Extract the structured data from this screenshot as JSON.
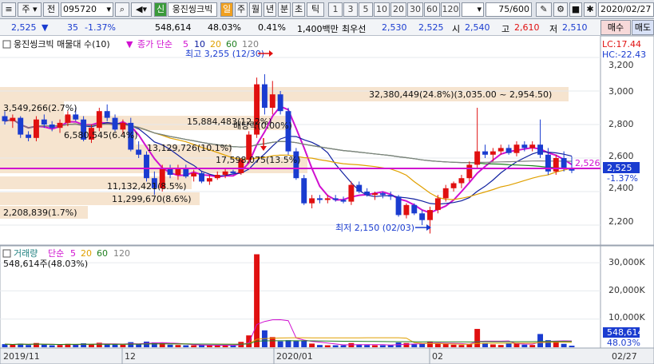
{
  "toolbar": {
    "menu_icon": "lines-icon",
    "market_label": "주",
    "period_label": "전",
    "code_value": "095720",
    "search_icon": "search-icon",
    "sound_icon": "speaker-icon",
    "new_label": "신",
    "stock_name": "웅진씽크빅",
    "tab_labels": [
      "일",
      "주",
      "월",
      "년",
      "분",
      "초",
      "틱"
    ],
    "number_tabs": [
      "1",
      "3",
      "5",
      "10",
      "20",
      "30",
      "60",
      "120"
    ],
    "count_value": "75",
    "count_total": "/600",
    "date_value": "2020/02/27"
  },
  "infobar": {
    "price": "2,525",
    "change": "35",
    "change_pct": "-1.37%",
    "volume": "548,614",
    "volume_ratio": "48.03%",
    "turnover": "0.41%",
    "trade_value": "1,400백만",
    "best_bid_label": "최우선",
    "ask": "2,530",
    "bid": "2,525",
    "open_label": "시",
    "open": "2,540",
    "high_label": "고",
    "high": "2,610",
    "low_label": "저",
    "low": "2,510",
    "buy_label": "매수",
    "sell_label": "매도"
  },
  "price_panel": {
    "title": "웅진씽크빅 매물대 수(10)",
    "ma_label": "종가 단순",
    "ma_periods": [
      "5",
      "10",
      "20",
      "60",
      "120"
    ],
    "ma_colors": [
      "#d010d0",
      "#1020a0",
      "#e0a000",
      "#208020",
      "#808080"
    ],
    "lc_label": "LC:17.44",
    "hc_label": "HC:-22.43",
    "y_ticks": [
      "3,200",
      "3,000",
      "2,800",
      "2,600",
      "2,400",
      "2,200"
    ],
    "last_price": "2,525",
    "last_change": "-1.37%",
    "ma_last": "2,526",
    "high_annot": "최고 3,255 (12/30)",
    "low_annot": "최저 2,150 (02/03)",
    "event_label": "배당락(0.00%)",
    "profile_labels": [
      "32,380,449(24.8%)(3,035.00 ~ 2,954.50)",
      "3,549,266(2.7%)",
      "15,884,483(12.2%)",
      "6,580,545(6.4%)",
      "13,129,726(10.1%)",
      "17,598,075(13.5%)",
      "11,132,421(8.5%)",
      "11,299,670(8.6%)",
      "2,208,839(1.7%)"
    ]
  },
  "volume_panel": {
    "title": "거래량",
    "ma_label": "단순",
    "ma_periods": [
      "5",
      "20",
      "60",
      "120"
    ],
    "value_label": "548,614주(48.03%)",
    "y_ticks": [
      "30,000K",
      "20,000K",
      "10,000K"
    ],
    "last_volume": "548,614",
    "last_ratio": "48.03%"
  },
  "x_axis": {
    "labels": [
      "2019/11",
      "12",
      "2020/01",
      "02"
    ],
    "last_date": "02/27"
  },
  "chart_data": {
    "type": "candlestick",
    "y_range": [
      2100,
      3300
    ],
    "volume_range": [
      0,
      34000
    ],
    "candles": [
      [
        2850,
        2880,
        2800,
        2820,
        1100
      ],
      [
        2820,
        2860,
        2780,
        2840,
        900
      ],
      [
        2840,
        2850,
        2720,
        2740,
        1300
      ],
      [
        2740,
        2760,
        2700,
        2720,
        800
      ],
      [
        2720,
        2850,
        2700,
        2830,
        1500
      ],
      [
        2830,
        2860,
        2780,
        2800,
        900
      ],
      [
        2800,
        2820,
        2760,
        2780,
        700
      ],
      [
        2780,
        2830,
        2750,
        2810,
        800
      ],
      [
        2810,
        2880,
        2790,
        2860,
        1200
      ],
      [
        2860,
        2900,
        2820,
        2830,
        900
      ],
      [
        2830,
        2850,
        2700,
        2710,
        1400
      ],
      [
        2710,
        2800,
        2690,
        2780,
        1000
      ],
      [
        2780,
        2900,
        2760,
        2880,
        1600
      ],
      [
        2880,
        2920,
        2820,
        2840,
        1100
      ],
      [
        2840,
        2860,
        2760,
        2770,
        1000
      ],
      [
        2770,
        2830,
        2740,
        2810,
        900
      ],
      [
        2810,
        2840,
        2640,
        2650,
        1800
      ],
      [
        2650,
        2700,
        2600,
        2620,
        1200
      ],
      [
        2620,
        2640,
        2460,
        2480,
        2000
      ],
      [
        2480,
        2520,
        2380,
        2420,
        1700
      ],
      [
        2420,
        2560,
        2400,
        2540,
        1500
      ],
      [
        2540,
        2560,
        2480,
        2500,
        900
      ],
      [
        2500,
        2560,
        2470,
        2540,
        800
      ],
      [
        2540,
        2560,
        2480,
        2490,
        700
      ],
      [
        2490,
        2530,
        2460,
        2510,
        700
      ],
      [
        2510,
        2520,
        2450,
        2460,
        800
      ],
      [
        2460,
        2500,
        2440,
        2480,
        700
      ],
      [
        2480,
        2520,
        2470,
        2500,
        600
      ],
      [
        2500,
        2540,
        2480,
        2520,
        700
      ],
      [
        2520,
        2530,
        2500,
        2510,
        600
      ],
      [
        2510,
        2600,
        2500,
        2590,
        1900
      ],
      [
        2590,
        2760,
        2570,
        2740,
        4200
      ],
      [
        2740,
        3080,
        2720,
        3040,
        33000
      ],
      [
        3040,
        3100,
        2860,
        2900,
        6000
      ],
      [
        2900,
        3060,
        2860,
        2980,
        3600
      ],
      [
        2980,
        3000,
        2860,
        2880,
        2100
      ],
      [
        2880,
        2900,
        2620,
        2640,
        2500
      ],
      [
        2640,
        2660,
        2470,
        2480,
        2200
      ],
      [
        2480,
        2500,
        2320,
        2330,
        2300
      ],
      [
        2330,
        2380,
        2300,
        2360,
        1300
      ],
      [
        2360,
        2380,
        2330,
        2350,
        800
      ],
      [
        2350,
        2380,
        2330,
        2360,
        700
      ],
      [
        2360,
        2380,
        2340,
        2350,
        700
      ],
      [
        2350,
        2370,
        2330,
        2340,
        700
      ],
      [
        2340,
        2460,
        2320,
        2440,
        1500
      ],
      [
        2440,
        2460,
        2390,
        2400,
        1000
      ],
      [
        2400,
        2420,
        2370,
        2380,
        800
      ],
      [
        2380,
        2400,
        2350,
        2390,
        700
      ],
      [
        2390,
        2400,
        2360,
        2380,
        700
      ],
      [
        2380,
        2400,
        2350,
        2370,
        800
      ],
      [
        2370,
        2380,
        2250,
        2260,
        1700
      ],
      [
        2260,
        2330,
        2240,
        2320,
        1500
      ],
      [
        2320,
        2330,
        2260,
        2270,
        1000
      ],
      [
        2270,
        2290,
        2200,
        2230,
        1300
      ],
      [
        2230,
        2310,
        2150,
        2290,
        2000
      ],
      [
        2290,
        2380,
        2270,
        2360,
        1600
      ],
      [
        2360,
        2440,
        2340,
        2420,
        1200
      ],
      [
        2420,
        2460,
        2400,
        2450,
        900
      ],
      [
        2450,
        2500,
        2420,
        2480,
        800
      ],
      [
        2480,
        2580,
        2460,
        2560,
        1000
      ],
      [
        2560,
        2900,
        2540,
        2640,
        6500
      ],
      [
        2640,
        2680,
        2600,
        2620,
        1500
      ],
      [
        2620,
        2660,
        2580,
        2640,
        1000
      ],
      [
        2640,
        2680,
        2620,
        2660,
        800
      ],
      [
        2660,
        2680,
        2620,
        2630,
        1400
      ],
      [
        2630,
        2700,
        2610,
        2680,
        1600
      ],
      [
        2680,
        2700,
        2640,
        2660,
        900
      ],
      [
        2660,
        2700,
        2640,
        2680,
        800
      ],
      [
        2680,
        2830,
        2600,
        2620,
        4700
      ],
      [
        2620,
        2660,
        2500,
        2520,
        2500
      ],
      [
        2520,
        2620,
        2500,
        2600,
        2200
      ],
      [
        2600,
        2640,
        2520,
        2540,
        1200
      ],
      [
        2540,
        2610,
        2510,
        2525,
        549
      ]
    ]
  }
}
